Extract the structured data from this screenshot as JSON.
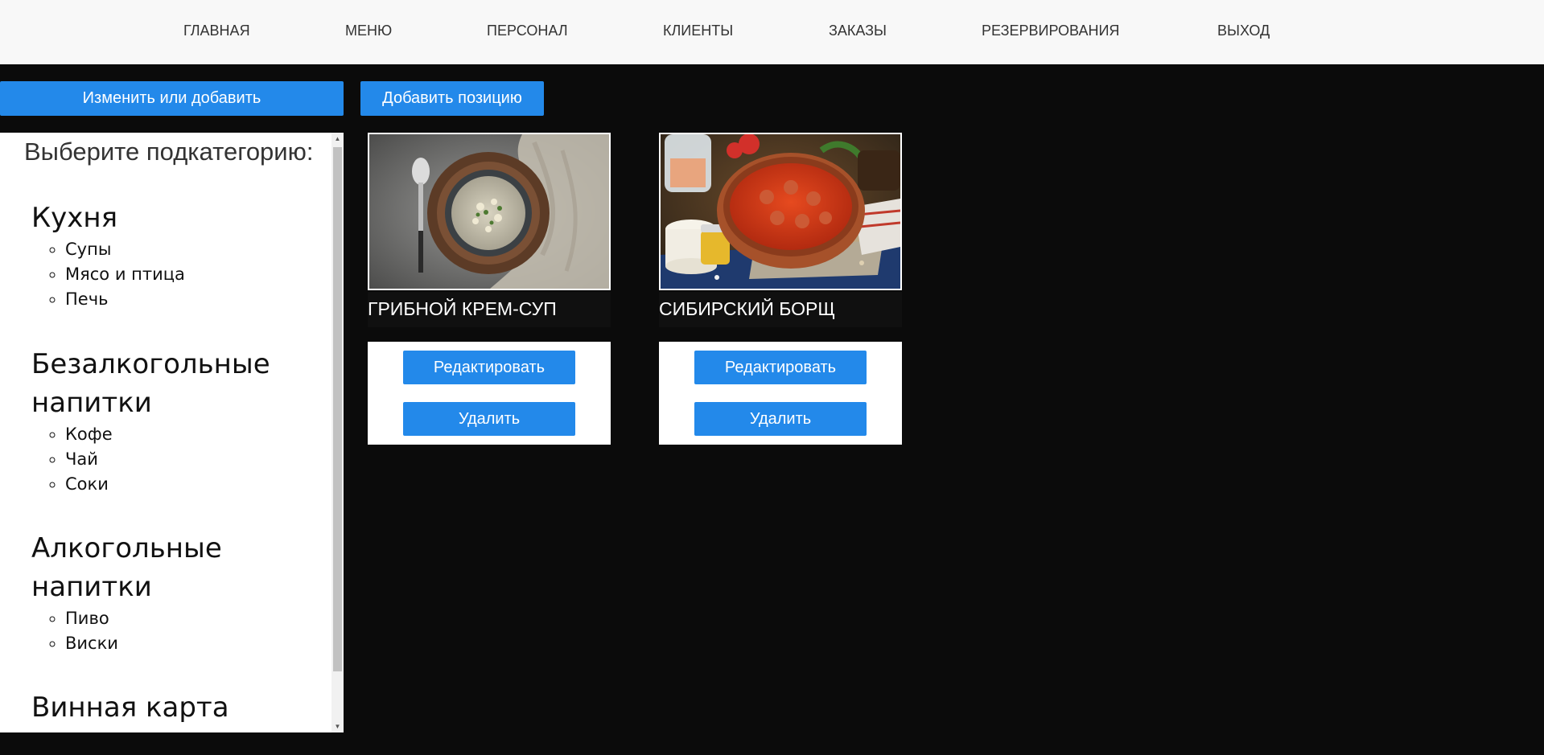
{
  "nav": {
    "items": [
      {
        "label": "ГЛАВНАЯ"
      },
      {
        "label": "МЕНЮ"
      },
      {
        "label": "ПЕРСОНАЛ"
      },
      {
        "label": "КЛИЕНТЫ"
      },
      {
        "label": "ЗАКАЗЫ"
      },
      {
        "label": "РЕЗЕРВИРОВАНИЯ"
      },
      {
        "label": "ВЫХОД"
      }
    ]
  },
  "toolbar": {
    "edit_or_add_label": "Изменить или добавить",
    "add_item_label": "Добавить позицию"
  },
  "sidebar": {
    "heading": "Выберите подкатегорию:",
    "categories": [
      {
        "title": "Кухня",
        "items": [
          "Супы",
          "Мясо и птица",
          "Печь"
        ]
      },
      {
        "title": "Безалкогольные напитки",
        "items": [
          "Кофе",
          "Чай",
          "Соки"
        ]
      },
      {
        "title": "Алкогольные напитки",
        "items": [
          "Пиво",
          "Виски"
        ]
      },
      {
        "title": "Винная карта",
        "items": []
      }
    ]
  },
  "cards": [
    {
      "title": "ГРИБНОЙ КРЕМ-СУП",
      "edit_label": "Редактировать",
      "delete_label": "Удалить"
    },
    {
      "title": "СИБИРСКИЙ БОРЩ",
      "edit_label": "Редактировать",
      "delete_label": "Удалить"
    }
  ],
  "colors": {
    "accent": "#2389ea",
    "background": "#0b0b0b",
    "nav_background": "#f8f8f8"
  }
}
